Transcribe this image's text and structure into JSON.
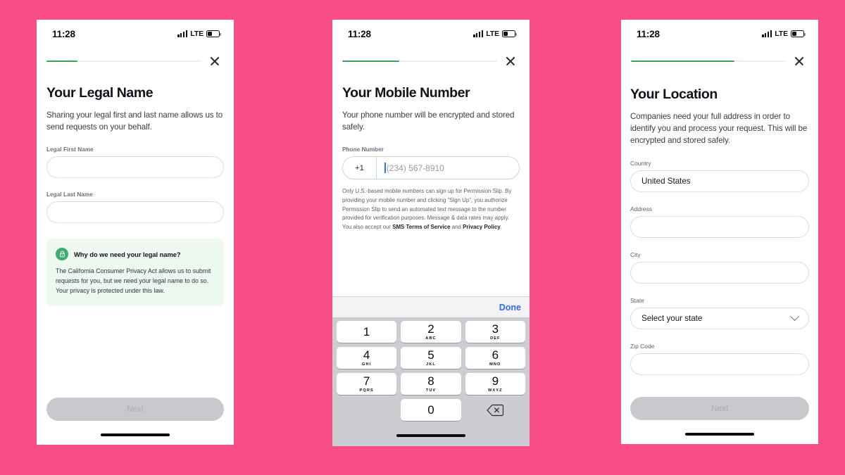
{
  "background_color": "#fa4e86",
  "accent_green": "#35a45f",
  "status_bar": {
    "time": "11:28",
    "network": "LTE",
    "signal_icon": "signal-bars-icon",
    "battery_icon": "battery-icon",
    "battery_level_pct": 42
  },
  "screens": [
    {
      "id": "legal-name",
      "progress_pct": 20,
      "close_label": "×",
      "title": "Your Legal Name",
      "subtitle": "Sharing your legal first and last name allows us to send requests on your behalf.",
      "fields": [
        {
          "label": "Legal First Name",
          "value": "",
          "placeholder": ""
        },
        {
          "label": "Legal Last Name",
          "value": "",
          "placeholder": ""
        }
      ],
      "info_card": {
        "icon": "lock-icon",
        "heading": "Why do we need your legal name?",
        "body": "The California Consumer Privacy Act allows us to submit requests for you, but we need your legal name to do so. Your privacy is protected under this law."
      },
      "primary_button": "Next"
    },
    {
      "id": "mobile-number",
      "progress_pct": 37,
      "close_label": "×",
      "title": "Your Mobile Number",
      "subtitle": "Your phone number will be encrypted and stored safely.",
      "phone_field": {
        "label": "Phone Number",
        "country_code": "+1",
        "value": "",
        "placeholder": "(234) 567-8910"
      },
      "disclaimer": {
        "part1": "Only U.S.-based mobile numbers can sign up for Permission Slip. By providing your mobile number and clicking “Sign Up”, you authorize Permission Slip to send an automated text message to the number provided for verification purposes. Message & data rates may apply. You also accept our ",
        "link1": "SMS Terms of Service",
        "mid": " and ",
        "link2": "Privacy Policy",
        "end": "."
      },
      "keyboard": {
        "done_label": "Done",
        "keys": [
          {
            "digit": "1",
            "letters": ""
          },
          {
            "digit": "2",
            "letters": "ABC"
          },
          {
            "digit": "3",
            "letters": "DEF"
          },
          {
            "digit": "4",
            "letters": "GHI"
          },
          {
            "digit": "5",
            "letters": "JKL"
          },
          {
            "digit": "6",
            "letters": "MNO"
          },
          {
            "digit": "7",
            "letters": "PQRS"
          },
          {
            "digit": "8",
            "letters": "TUV"
          },
          {
            "digit": "9",
            "letters": "WXYZ"
          },
          {
            "digit": "0",
            "letters": ""
          }
        ],
        "delete_icon": "backspace-icon"
      }
    },
    {
      "id": "location",
      "progress_pct": 67,
      "close_label": "×",
      "title": "Your Location",
      "subtitle": "Companies need your full address in order to identify you and process your request. This will be encrypted and stored safely.",
      "fields": [
        {
          "label": "Country",
          "value": "United States",
          "type": "text"
        },
        {
          "label": "Address",
          "value": "",
          "type": "text"
        },
        {
          "label": "City",
          "value": "",
          "type": "text"
        },
        {
          "label": "State",
          "value": "Select your state",
          "type": "select",
          "chevron_icon": "chevron-down-icon"
        },
        {
          "label": "Zip Code",
          "value": "",
          "type": "text"
        }
      ],
      "primary_button": "Next"
    }
  ]
}
